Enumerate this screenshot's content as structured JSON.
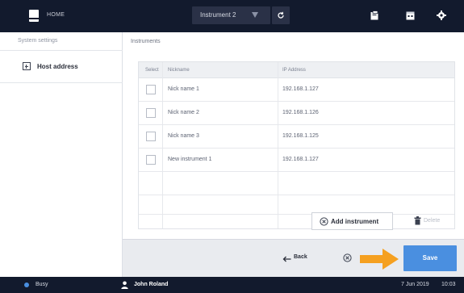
{
  "header": {
    "home_label": "HOME",
    "instrument_selected": "Instrument 2",
    "icons": [
      "home-icon",
      "filter-icon",
      "refresh-icon",
      "clipboard-icon",
      "calendar-icon",
      "settings-icon"
    ]
  },
  "sidebar": {
    "title": "System settings",
    "items": [
      {
        "label": "Host address",
        "icon": "plus-box-icon",
        "active": true
      }
    ]
  },
  "main": {
    "section_title": "Instruments",
    "table": {
      "columns": [
        "Select",
        "Nickname",
        "IP Address"
      ],
      "rows": [
        {
          "nickname": "Nick name 1",
          "ip": "192.168.1.127"
        },
        {
          "nickname": "Nick name 2",
          "ip": "192.168.1.126"
        },
        {
          "nickname": "Nick name 3",
          "ip": "192.168.1.125"
        },
        {
          "nickname": "New instrument 1",
          "ip": "192.168.1.127"
        },
        {
          "nickname": "",
          "ip": ""
        },
        {
          "nickname": "",
          "ip": ""
        }
      ]
    },
    "add_instrument_label": "Add instrument",
    "delete_label": "Delete"
  },
  "actions": {
    "back_label": "Back",
    "save_label": "Save",
    "accent_color": "#4a8fe0",
    "highlight_arrow_color": "#f5a020"
  },
  "status": {
    "state": "Busy",
    "user": "John Roland",
    "date": "7 Jun 2019",
    "time": "10:03"
  }
}
